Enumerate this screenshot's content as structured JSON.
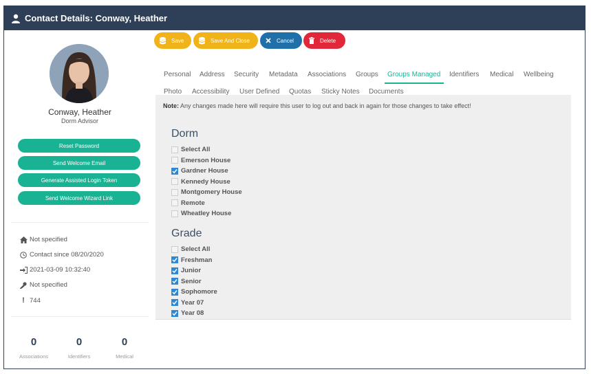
{
  "window": {
    "title": "Contact Details: Conway, Heather"
  },
  "profile": {
    "name": "Conway, Heather",
    "role": "Dorm Advisor",
    "actions": [
      "Reset Password",
      "Send Welcome Email",
      "Generate Assisted Login Token",
      "Send Welcome Wizard Link"
    ],
    "info": [
      {
        "icon": "home-icon",
        "text": "Not specified"
      },
      {
        "icon": "clock-icon",
        "text": "Contact since 08/20/2020"
      },
      {
        "icon": "sign-in-icon",
        "text": "2021-03-09 10:32:40"
      },
      {
        "icon": "key-icon",
        "text": "Not specified"
      },
      {
        "icon": "exclamation-icon",
        "text": "744"
      }
    ],
    "stats": [
      {
        "value": "0",
        "label": "Associations"
      },
      {
        "value": "0",
        "label": "Identifiers"
      },
      {
        "value": "0",
        "label": "Medical"
      }
    ]
  },
  "toolbar": {
    "save": "Save",
    "save_close": "Save And Close",
    "cancel": "Cancel",
    "delete": "Delete"
  },
  "tabs_row1": [
    "Personal",
    "Address",
    "Security",
    "Metadata",
    "Associations",
    "Groups",
    "Groups Managed",
    "Identifiers",
    "Medical",
    "Wellbeing"
  ],
  "tabs_row2": [
    "Photo",
    "Accessibility",
    "User Defined",
    "Quotas",
    "Sticky Notes",
    "Documents"
  ],
  "active_tab": "Groups Managed",
  "note": {
    "label": "Note:",
    "text": " Any changes made here will require this user to log out and back in again for those changes to take effect!"
  },
  "groups": [
    {
      "title": "Dorm",
      "items": [
        {
          "label": "Select All",
          "checked": false
        },
        {
          "label": "Emerson House",
          "checked": false
        },
        {
          "label": "Gardner House",
          "checked": true
        },
        {
          "label": "Kennedy House",
          "checked": false
        },
        {
          "label": "Montgomery House",
          "checked": false
        },
        {
          "label": "Remote",
          "checked": false
        },
        {
          "label": "Wheatley House",
          "checked": false
        }
      ]
    },
    {
      "title": "Grade",
      "items": [
        {
          "label": "Select All",
          "checked": false
        },
        {
          "label": "Freshman",
          "checked": true
        },
        {
          "label": "Junior",
          "checked": true
        },
        {
          "label": "Senior",
          "checked": true
        },
        {
          "label": "Sophomore",
          "checked": true
        },
        {
          "label": "Year 07",
          "checked": true
        },
        {
          "label": "Year 08",
          "checked": true
        }
      ]
    }
  ],
  "colors": {
    "header": "#2e4057",
    "accent": "#19b394",
    "save": "#f0b41a",
    "cancel": "#1f6fa8",
    "delete": "#e0283a",
    "checkbox": "#2f88d1"
  }
}
